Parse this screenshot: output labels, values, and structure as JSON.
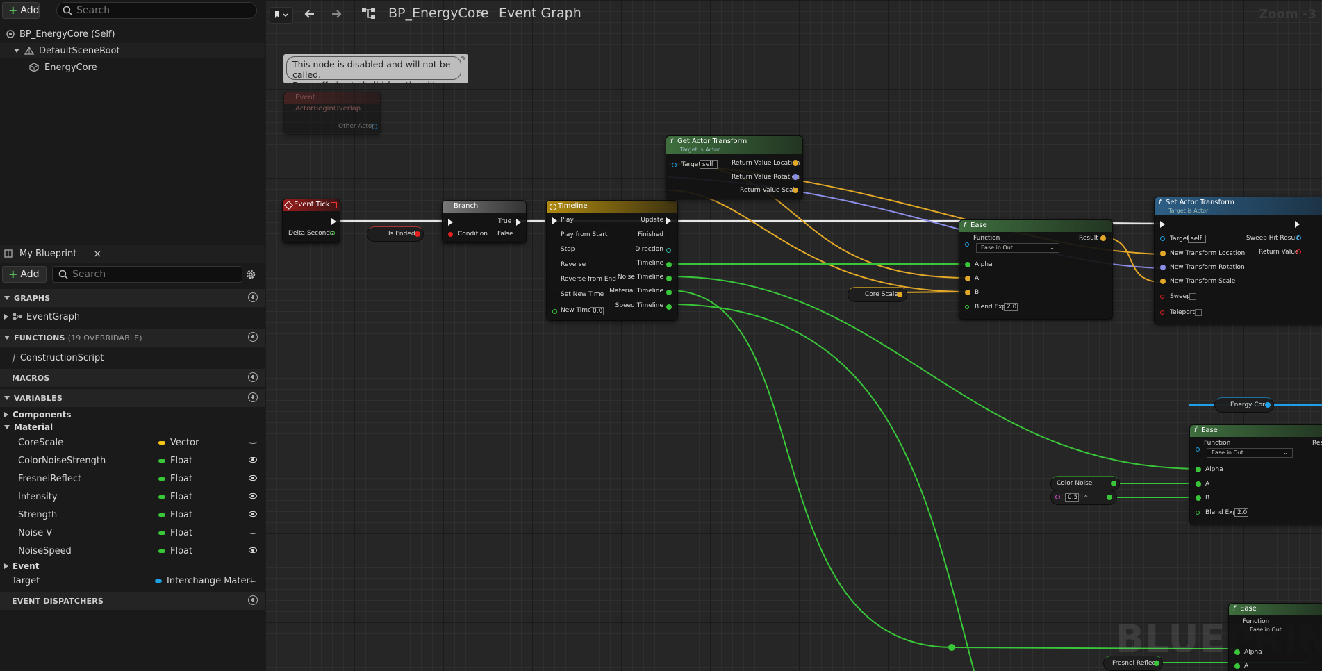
{
  "left_top": {
    "add_label": "Add",
    "search_placeholder": "Search",
    "tree": [
      {
        "label": "BP_EnergyCore (Self)"
      },
      {
        "label": "DefaultSceneRoot"
      },
      {
        "label": "EnergyCore"
      }
    ]
  },
  "my_blueprint": {
    "tab_label": "My Blueprint",
    "add_label": "Add",
    "search_placeholder": "Search",
    "sections": {
      "graphs": "GRAPHS",
      "functions": "FUNCTIONS",
      "functions_note": "(19 OVERRIDABLE)",
      "macros": "MACROS",
      "variables": "VARIABLES",
      "event_dispatchers": "EVENT DISPATCHERS"
    },
    "graphs_items": [
      "EventGraph"
    ],
    "functions_items": [
      "ConstructionScript"
    ],
    "var_categories": {
      "components": "Components",
      "material": "Material",
      "event": "Event"
    },
    "variables": [
      {
        "name": "CoreScale",
        "type": "Vector",
        "color": "#f5c518",
        "visible": false
      },
      {
        "name": "ColorNoiseStrength",
        "type": "Float",
        "color": "#39c639",
        "visible": true
      },
      {
        "name": "FresnelReflect",
        "type": "Float",
        "color": "#39c639",
        "visible": true
      },
      {
        "name": "Intensity",
        "type": "Float",
        "color": "#39c639",
        "visible": true
      },
      {
        "name": "Strength",
        "type": "Float",
        "color": "#39c639",
        "visible": true
      },
      {
        "name": "Noise V",
        "type": "Float",
        "color": "#39c639",
        "visible": false
      },
      {
        "name": "NoiseSpeed",
        "type": "Float",
        "color": "#39c639",
        "visible": true
      }
    ],
    "target_var": {
      "name": "Target",
      "type": "Interchange Materi",
      "color": "#1ea0e6",
      "visible": false
    }
  },
  "graph": {
    "breadcrumb": {
      "blueprint": "BP_EnergyCore",
      "graph": "Event Graph"
    },
    "zoom": "Zoom -3",
    "watermark": "BLUEPRINT",
    "comment": "This node is disabled and will not be called.\nDrag off pins to build functionality.",
    "nodes": {
      "overlap": {
        "title": "Event ActorBeginOverlap",
        "pin": "Other Actor"
      },
      "tick": {
        "title": "Event Tick",
        "pin": "Delta Seconds"
      },
      "is_ended": "Is Ended",
      "branch": {
        "title": "Branch",
        "condition": "Condition",
        "true": "True",
        "false": "False"
      },
      "timeline": {
        "title": "Timeline",
        "inputs": [
          "Play",
          "Play from Start",
          "Stop",
          "Reverse",
          "Reverse from End",
          "Set New Time",
          "New Time"
        ],
        "new_time": "0.0",
        "outputs": [
          "Update",
          "Finished",
          "Direction",
          "Timeline",
          "Noise Timeline",
          "Material Timeline",
          "Speed Timeline"
        ]
      },
      "get_transform": {
        "title": "Get Actor Transform",
        "subtitle": "Target is Actor",
        "target": "Target",
        "self": "self",
        "outputs": [
          "Return Value Location",
          "Return Value Rotation",
          "Return Value Scale"
        ]
      },
      "ease1": {
        "title": "Ease",
        "function": "Function",
        "func_value": "Ease in Out",
        "result": "Result",
        "alpha": "Alpha",
        "a": "A",
        "b": "B",
        "blend": "Blend Exp",
        "blend_val": "2.0"
      },
      "core_scale": "Core Scale",
      "set_transform": {
        "title": "Set Actor Transform",
        "subtitle": "Target is Actor",
        "target": "Target",
        "self": "self",
        "inputs": [
          "New Transform Location",
          "New Transform Rotation",
          "New Transform Scale",
          "Sweep",
          "Teleport"
        ],
        "sweep_result": "Sweep Hit Result",
        "return_value": "Return Value"
      },
      "energy_core": "Energy Core",
      "ease2": {
        "title": "Ease",
        "function": "Function",
        "func_value": "Ease in Out",
        "result": "Resu",
        "alpha": "Alpha",
        "a": "A",
        "b": "B",
        "blend": "Blend Exp",
        "blend_val": "2.0"
      },
      "color_noise": "Color Noise Strength",
      "mult": {
        "value": "0.5",
        "op": "*"
      },
      "ease3": {
        "title": "Ease",
        "function": "Function",
        "func_value": "Ease in Out",
        "alpha": "Alpha",
        "a": "A"
      },
      "fresnel": "Fresnel Reflect"
    }
  }
}
